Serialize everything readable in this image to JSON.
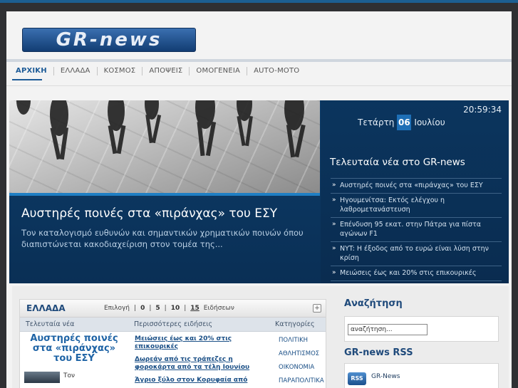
{
  "header": {
    "logo_text": "GR-news"
  },
  "nav": {
    "items": [
      "ΑΡΧΙΚΗ",
      "ΕΛΛΑΔΑ",
      "ΚΟΣΜΟΣ",
      "ΑΠΟΨΕΙΣ",
      "ΟΜΟΓΕΝΕΙΑ",
      "AUTO-MOTO"
    ],
    "active": "ΑΡΧΙΚΗ"
  },
  "hero": {
    "headline": "Αυστηρές ποινές στα «πιράνχας» του ΕΣΥ",
    "text": "Τον καταλογισμό ευθυνών και σημαντικών χρηματικών ποινών όπου διαπιστώνεται κακοδιαχείριση στον τομέα της..."
  },
  "date_panel": {
    "clock": "20:59:34",
    "weekday": "Τετάρτη",
    "day": "06",
    "month": "Ιουλίου"
  },
  "latest": {
    "title": "Τελευταία νέα στο GR-news",
    "items": [
      "Αυστηρές ποινές στα «πιράνχας» του ΕΣΥ",
      "Ηγουμενίτσα: Εκτός ελέγχου η λαθρομετανάστευση",
      "Επένδυση 95 εκατ. στην Πάτρα για πίστα αγώνων F1",
      "NYT: Η έξοδος από το ευρώ είναι λύση στην κρίση",
      "Μειώσεις έως και 20% στις επικουρικές"
    ]
  },
  "section_box": {
    "title": "ΕΛΛΑΔΑ",
    "choose_label": "Επιλογή",
    "counts": [
      "0",
      "5",
      "10",
      "15"
    ],
    "selected_count": "15",
    "suffix": "Ειδήσεων",
    "col_headers": [
      "Τελευταία νέα",
      "Περισσότερες ειδήσεις",
      "Κατηγορίες"
    ],
    "main_story": "Αυστηρές ποινές στα «πιράνχας» του ΕΣΥ",
    "main_snippet": "Τον",
    "more_news": [
      "Μειώσεις έως και 20% στις επικουρικές",
      "Δωρεάν από τις τράπεζες η φοροκάρτα από τα τέλη Ιουνίου",
      "Άγριο ξύλο στον Κορυφαία από"
    ],
    "categories": [
      "ΠΟΛΙΤΙΚΗ",
      "ΑΘΛΗΤΙΣΜΟΣ",
      "ΟΙΚΟΝΟΜΙΑ",
      "ΠΑΡΑΠΟΛΙΤΙΚΑ"
    ]
  },
  "sidebar": {
    "search_title": "Αναζήτηση",
    "search_placeholder": "αναζήτηση...",
    "rss_title": "GR-news RSS",
    "rss_icon_text": "RSS",
    "rss_label": "GR-News"
  }
}
